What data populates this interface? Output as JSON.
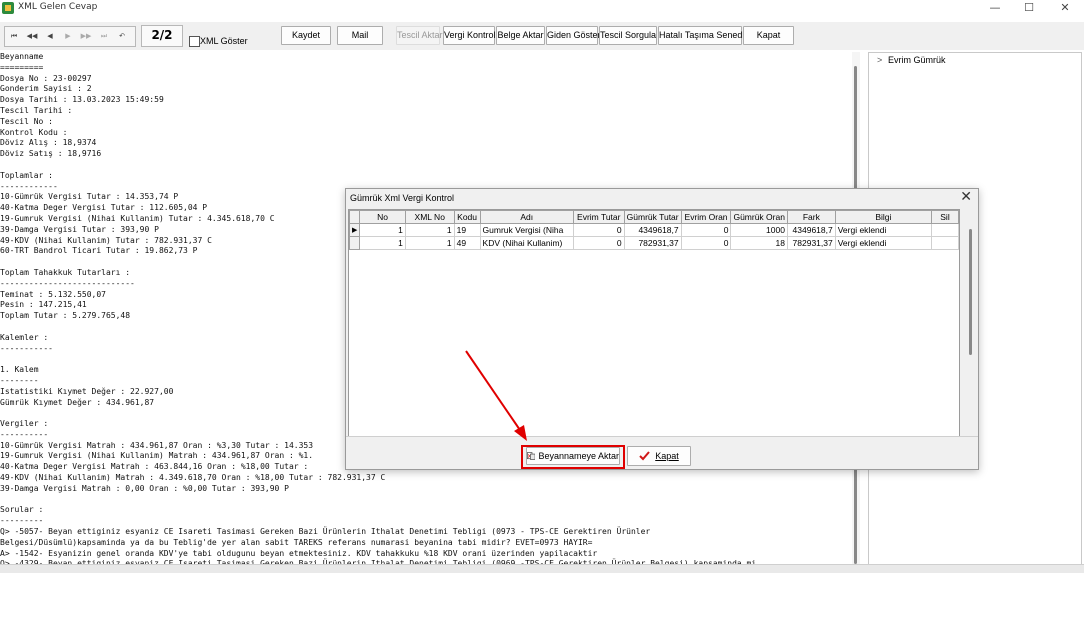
{
  "window": {
    "title": "XML Gelen Cevap",
    "minimize": "—",
    "maximize": "☐",
    "close": "✕"
  },
  "toolbar": {
    "nav": [
      "⏮",
      "◀◀",
      "◀",
      "▶",
      "▶▶",
      "⏭",
      "↶"
    ],
    "page": "2/2",
    "xml_goster": "XML Göster",
    "buttons": {
      "kaydet": "Kaydet",
      "mail": "Mail",
      "tescil_aktar": "Tescil Aktar",
      "vergi_kontrol": "Vergi Kontrol",
      "belge_aktar": "Belge Aktar",
      "giden_goster": "Giden Göster",
      "tescil_sorgula": "Tescil Sorgula",
      "hatali_tasima": "Hatalı Taşıma Senedi",
      "kapat": "Kapat"
    }
  },
  "tree": {
    "root": "Evrim Gümrük",
    "expander": ">"
  },
  "text_lines": [
    "Beyanname",
    "=========",
    "Dosya No : 23-00297",
    "Gonderim Sayisi : 2",
    "Dosya Tarihi : 13.03.2023 15:49:59",
    "Tescil Tarihi :",
    "Tescil No :",
    "Kontrol Kodu :",
    "Döviz Alış : 18,9374",
    "Döviz Satış : 18,9716",
    "",
    "Toplamlar :",
    "------------",
    "10-Gümrük Vergisi Tutar : 14.353,74 P",
    "40-Katma Deger Vergisi Tutar : 112.605,04 P",
    "19-Gumruk Vergisi (Nihai Kullanim) Tutar : 4.345.618,70 C",
    "39-Damga Vergisi Tutar : 393,90 P",
    "49-KDV (Nihai Kullanim) Tutar : 782.931,37 C",
    "60-TRT Bandrol Ticari Tutar : 19.862,73 P",
    "",
    "Toplam Tahakkuk Tutarları :",
    "----------------------------",
    "Teminat : 5.132.550,07",
    "Pesin : 147.215,41",
    "Toplam Tutar : 5.279.765,48",
    "",
    "Kalemler :",
    "-----------",
    "",
    "1. Kalem",
    "--------",
    "Istatistiki Kıymet Değer : 22.927,00",
    "Gümrük Kıymet Değer : 434.961,87",
    "",
    "Vergiler :",
    "----------",
    "10-Gümrük Vergisi Matrah : 434.961,87 Oran : %3,30 Tutar : 14.353",
    "19-Gumruk Vergisi (Nihai Kullanim) Matrah : 434.961,87 Oran : %1.",
    "40-Katma Deger Vergisi Matrah : 463.844,16 Oran : %18,00 Tutar :",
    "49-KDV (Nihai Kullanim) Matrah : 4.349.618,70 Oran : %18,00 Tutar : 782.931,37 C",
    "39-Damga Vergisi Matrah : 0,00 Oran : %0,00 Tutar : 393,90 P",
    "",
    "Sorular :",
    "---------",
    "Q> -5057- Beyan ettiginiz esyaniz CE Isareti Tasimasi Gereken Bazi Ürünlerin Ithalat Denetimi Tebligi (0973 - TPS-CE Gerektiren Ürünler",
    "Belgesi/Düsümlü)kapsaminda ya da bu Teblig'de yer alan sabit TAREKS referans numarasi beyanina tabi midir? EVET=0973 HAYIR=",
    "A> -1542- Esyanizin genel oranda KDV'ye tabi oldugunu beyan etmektesiniz. KDV tahakkuku %18 KDV orani üzerinden yapilacaktir",
    "Q> -4329- Beyan ettiginiz esyaniz CE Isareti Tasimasi Gereken Bazi Ürünlerin Ithalat Denetimi Tebligi (0969 -TPS-CE Gerektiren Ürünler Belgesi) kapsaminda mi"
  ],
  "dialog": {
    "title": "Gümrük Xml Vergi Kontrol",
    "close": "✕",
    "columns": [
      "",
      "No",
      "XML No",
      "Kodu",
      "Adı",
      "Evrim Tutar",
      "Gümrük Tutar",
      "Evrim Oran",
      "Gümrük Oran",
      "Fark",
      "Bilgi",
      "Sil"
    ],
    "rows": [
      {
        "marker": "▶",
        "no": "1",
        "xml_no": "1",
        "kodu": "19",
        "adi": "Gumruk Vergisi (Niha",
        "evrim_tutar": "0",
        "gumruk_tutar": "4349618,7",
        "evrim_oran": "0",
        "gumruk_oran": "1000",
        "fark": "4349618,7",
        "bilgi": "Vergi eklendi",
        "sil": ""
      },
      {
        "marker": "",
        "no": "1",
        "xml_no": "1",
        "kodu": "49",
        "adi": "KDV (Nihai Kullanim)",
        "evrim_tutar": "0",
        "gumruk_tutar": "782931,37",
        "evrim_oran": "0",
        "gumruk_oran": "18",
        "fark": "782931,37",
        "bilgi": "Vergi eklendi",
        "sil": ""
      }
    ],
    "buttons": {
      "aktar": "Beyannameye Aktar",
      "kapat": "Kapat"
    }
  },
  "colors": {
    "highlight": "#e00000",
    "arrow": "#e00000"
  }
}
